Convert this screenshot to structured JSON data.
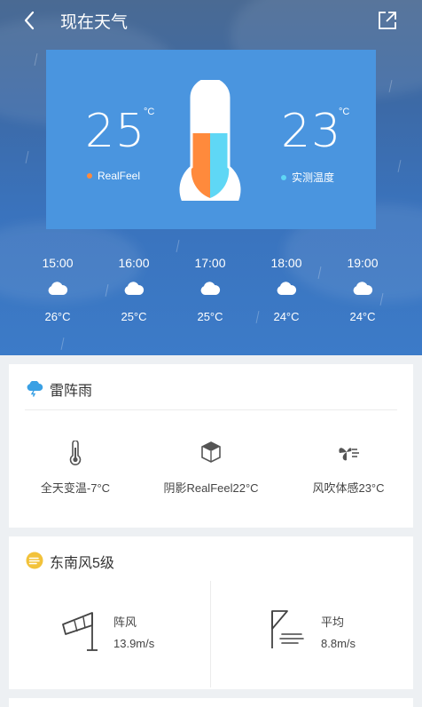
{
  "header": {
    "title": "现在天气"
  },
  "temp_card": {
    "realfeel_value": "25",
    "realfeel_unit": "°C",
    "realfeel_label": "RealFeel",
    "measured_value": "23",
    "measured_unit": "°C",
    "measured_label": "实测温度",
    "colors": {
      "realfeel": "#ff8a3c",
      "measured": "#5fd7f5"
    }
  },
  "hourly": [
    {
      "time": "15:00",
      "temp": "26°C",
      "icon": "cloud-icon"
    },
    {
      "time": "16:00",
      "temp": "25°C",
      "icon": "cloud-icon"
    },
    {
      "time": "17:00",
      "temp": "25°C",
      "icon": "cloud-icon"
    },
    {
      "time": "18:00",
      "temp": "24°C",
      "icon": "cloud-icon"
    },
    {
      "time": "19:00",
      "temp": "24°C",
      "icon": "cloud-icon"
    }
  ],
  "condition_card": {
    "title": "雷阵雨",
    "icon": "thunder-cloud-icon",
    "metrics": [
      {
        "label": "全天变温-7°C",
        "icon": "thermometer-icon"
      },
      {
        "label": "阴影RealFeel22°C",
        "icon": "shade-cube-icon"
      },
      {
        "label": "风吹体感23°C",
        "icon": "fan-wind-icon"
      }
    ]
  },
  "wind_card": {
    "title": "东南风5级",
    "icon": "wind-badge-icon",
    "gust": {
      "label": "阵风",
      "value": "13.9m/s",
      "icon": "windsock-icon"
    },
    "average": {
      "label": "平均",
      "value": "8.8m/s",
      "icon": "wind-flag-icon"
    }
  }
}
